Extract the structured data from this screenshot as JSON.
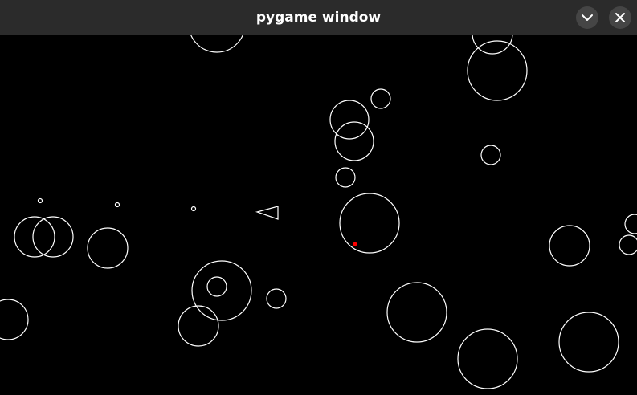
{
  "window": {
    "title": "pygame window",
    "minimize_icon": "chevron-down-icon",
    "close_icon": "close-icon"
  },
  "colors": {
    "titlebar_bg": "#2b2b2b",
    "button_bg": "#454545",
    "background": "#000000",
    "outline": "#ffffff",
    "bullet": "#ff0000"
  }
}
